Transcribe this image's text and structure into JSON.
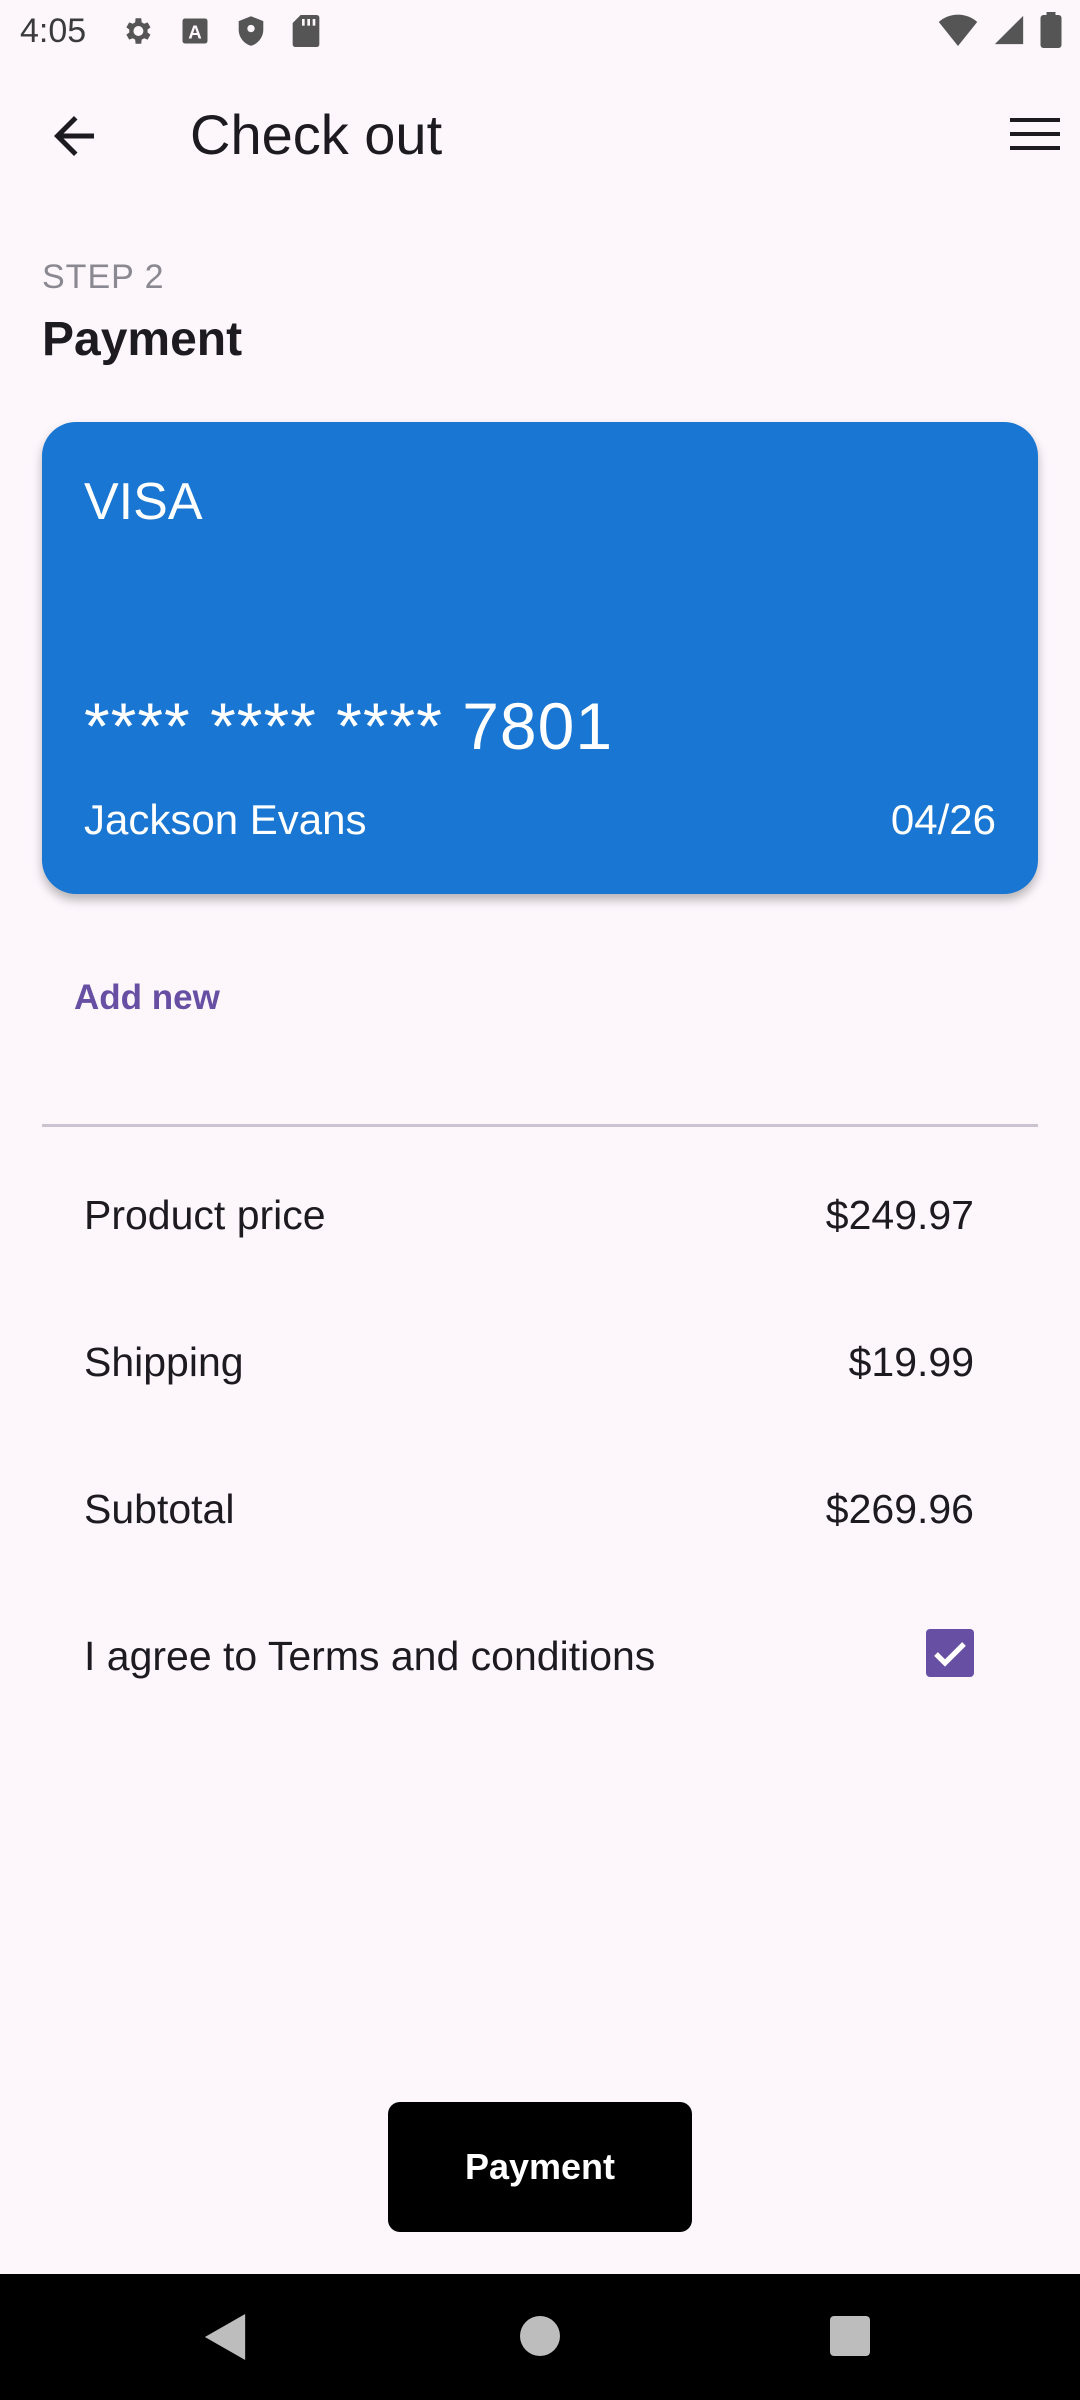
{
  "status_bar": {
    "time": "4:05",
    "left_icons": [
      "gear-icon",
      "font-a-icon",
      "shield-icon",
      "sd-card-icon"
    ],
    "right_icons": [
      "wifi-icon",
      "signal-icon",
      "battery-icon"
    ]
  },
  "app_bar": {
    "title": "Check out",
    "back_icon": "arrow-back-icon",
    "menu_icon": "menu-icon"
  },
  "step": {
    "label": "STEP 2",
    "title": "Payment"
  },
  "card": {
    "brand": "VISA",
    "number": "**** **** **** 7801",
    "holder": "Jackson Evans",
    "expiry": "04/26",
    "color": "#1976d2"
  },
  "add_new_label": "Add new",
  "summary": {
    "product_price": {
      "label": "Product price",
      "value": "$249.97"
    },
    "shipping": {
      "label": "Shipping",
      "value": "$19.99"
    },
    "subtotal": {
      "label": "Subtotal",
      "value": "$269.96"
    }
  },
  "terms": {
    "label": "I agree to Terms and conditions",
    "checked": true
  },
  "payment_button_label": "Payment",
  "colors": {
    "accent": "#6750a4",
    "background": "#fdf7fc"
  }
}
